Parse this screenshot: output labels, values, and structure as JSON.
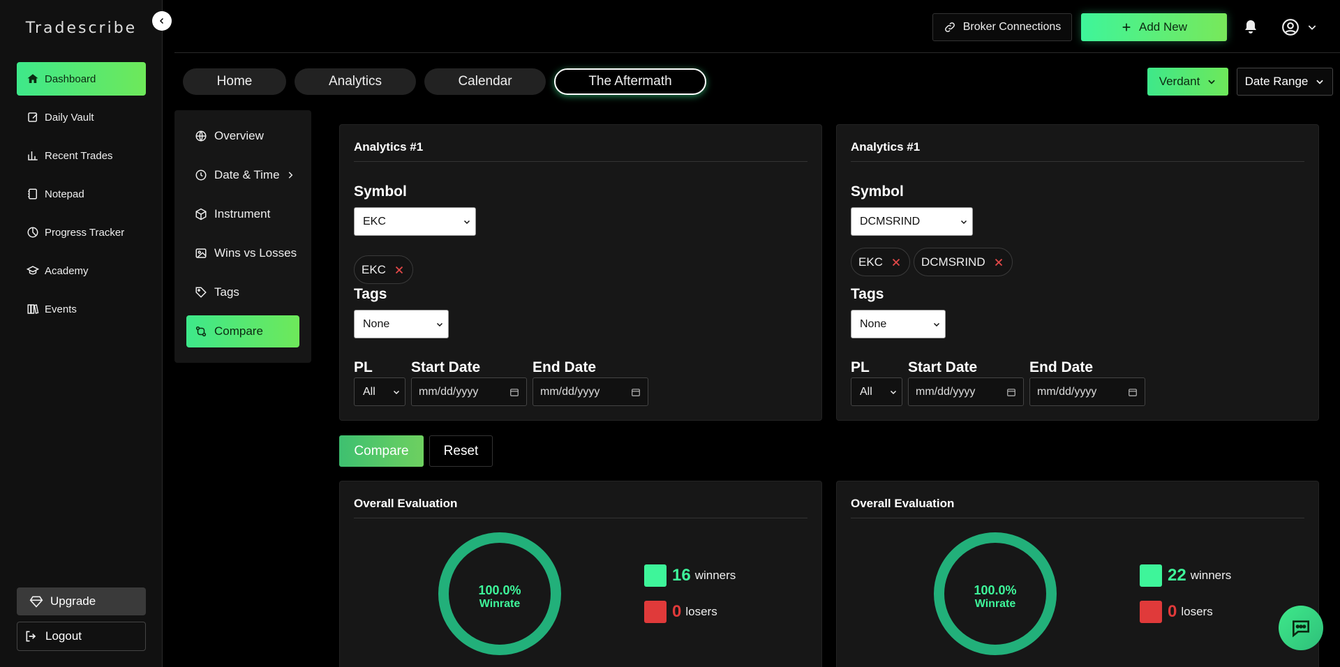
{
  "brand": "Tradescribe",
  "sidebar": {
    "items": [
      {
        "label": "Dashboard",
        "icon": "home-icon",
        "active": true
      },
      {
        "label": "Daily Vault",
        "icon": "edit-square-icon"
      },
      {
        "label": "Recent Trades",
        "icon": "bar-chart-icon"
      },
      {
        "label": "Notepad",
        "icon": "notepad-icon"
      },
      {
        "label": "Progress Tracker",
        "icon": "progress-icon"
      },
      {
        "label": "Academy",
        "icon": "graduation-cap-icon"
      },
      {
        "label": "Events",
        "icon": "books-icon"
      }
    ],
    "upgrade": "Upgrade",
    "logout": "Logout"
  },
  "header": {
    "broker": "Broker Connections",
    "add_new": "Add New"
  },
  "tabs": [
    "Home",
    "Analytics",
    "Calendar",
    "The Aftermath"
  ],
  "account_selector": "Verdant",
  "date_range": "Date Range",
  "submenu": [
    "Overview",
    "Date & Time",
    "Instrument",
    "Wins vs Losses",
    "Tags",
    "Compare"
  ],
  "panels": [
    {
      "title": "Analytics #1",
      "symbol_label": "Symbol",
      "symbol_value": "EKC",
      "chips": [
        "EKC"
      ],
      "tags_label": "Tags",
      "tags_value": "None",
      "pl_label": "PL",
      "pl_value": "All",
      "start_label": "Start Date",
      "end_label": "End Date",
      "date_placeholder": "mm/dd/yyyy"
    },
    {
      "title": "Analytics #1",
      "symbol_label": "Symbol",
      "symbol_value": "DCMSRIND",
      "chips": [
        "EKC",
        "DCMSRIND"
      ],
      "tags_label": "Tags",
      "tags_value": "None",
      "pl_label": "PL",
      "pl_value": "All",
      "start_label": "Start Date",
      "end_label": "End Date",
      "date_placeholder": "mm/dd/yyyy"
    }
  ],
  "actions": {
    "compare": "Compare",
    "reset": "Reset"
  },
  "evaluations": [
    {
      "title": "Overall Evaluation",
      "winrate": "100.0%",
      "winrate_label": "Winrate",
      "winners": "16",
      "winners_label": "winners",
      "losers": "0",
      "losers_label": "losers"
    },
    {
      "title": "Overall Evaluation",
      "winrate": "100.0%",
      "winrate_label": "Winrate",
      "winners": "22",
      "winners_label": "winners",
      "losers": "0",
      "losers_label": "losers"
    }
  ],
  "colors": {
    "accent": "#3ef59a",
    "win": "#3ef59a",
    "loss": "#e03a3a",
    "ring": "#22b07a"
  }
}
